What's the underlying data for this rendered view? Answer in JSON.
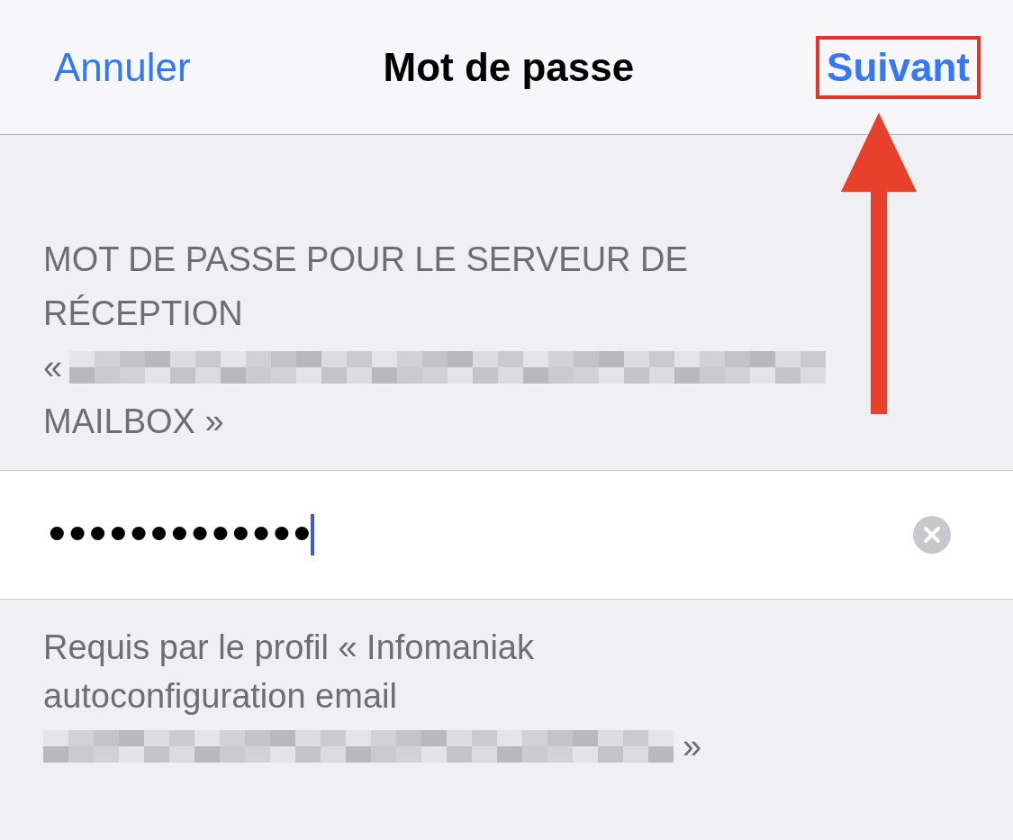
{
  "nav": {
    "cancel": "Annuler",
    "title": "Mot de passe",
    "next": "Suivant",
    "next_highlighted": true
  },
  "header_lines": [
    {
      "kind": "text",
      "text": "MOT DE PASSE POUR LE SERVEUR DE"
    },
    {
      "kind": "text",
      "text": "RÉCEPTION"
    },
    {
      "kind": "redacted",
      "before": "«"
    },
    {
      "kind": "text",
      "text": "MAILBOX »"
    }
  ],
  "password": {
    "value": "•••••••••••••",
    "focused": true
  },
  "footer_lines": [
    {
      "kind": "text",
      "text": "Requis par le profil « Infomaniak"
    },
    {
      "kind": "text",
      "text": "autoconfiguration email"
    },
    {
      "kind": "redacted",
      "after": "»"
    }
  ]
}
